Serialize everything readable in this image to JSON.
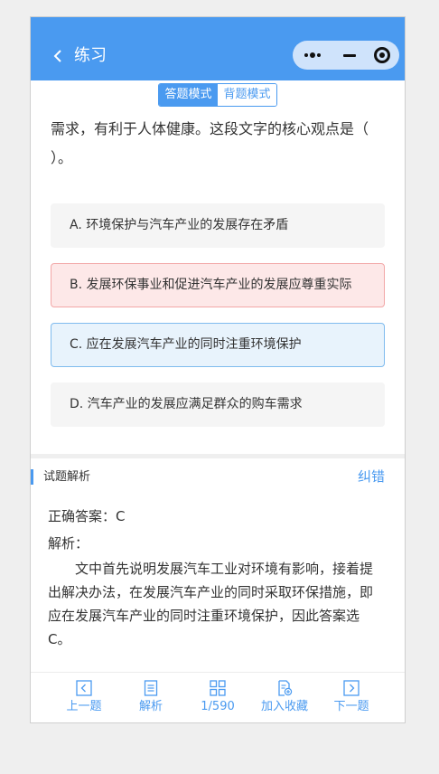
{
  "header": {
    "back_icon": "chevron-left-icon",
    "title": "练习",
    "capsule": {
      "more_icon": "more-dots-icon",
      "minimize_icon": "minimize-icon",
      "close_icon": "target-circle-icon"
    }
  },
  "mode_switch": {
    "answer_mode": "答题模式",
    "recite_mode": "背题模式",
    "active": "answer_mode"
  },
  "question": {
    "text": "需求，有利于人体健康。这段文字的核心观点是（ ）。",
    "options": [
      {
        "label": "A. 环境保护与汽车产业的发展存在矛盾",
        "state": "normal"
      },
      {
        "label": "B. 发展环保事业和促进汽车产业的发展应尊重实际",
        "state": "wrong"
      },
      {
        "label": "C. 应在发展汽车产业的同时注重环境保护",
        "state": "correct"
      },
      {
        "label": "D. 汽车产业的发展应满足群众的购车需求",
        "state": "normal"
      }
    ]
  },
  "analysis": {
    "title": "试题解析",
    "report_link": "纠错",
    "correct_answer": "正确答案：C",
    "explanation_label": "解析：",
    "explanation_text": "文中首先说明发展汽车工业对环境有影响，接着提出解决办法，在发展汽车产业的同时采取环保措施，即应在发展汽车产业的同时注重环境保护，因此答案选C。"
  },
  "toolbar": {
    "prev": {
      "label": "上一题",
      "icon": "prev-square-icon"
    },
    "analysis": {
      "label": "解析",
      "icon": "document-icon"
    },
    "progress": {
      "label": "1/590",
      "icon": "grid-icon"
    },
    "favorite": {
      "label": "加入收藏",
      "icon": "add-favorite-icon"
    },
    "next": {
      "label": "下一题",
      "icon": "next-square-icon"
    }
  },
  "colors": {
    "primary": "#4a9af0",
    "wrong_bg": "#fde8e8",
    "wrong_border": "#f2a7a7",
    "correct_bg": "#e8f3fc",
    "correct_border": "#7fbbee"
  }
}
